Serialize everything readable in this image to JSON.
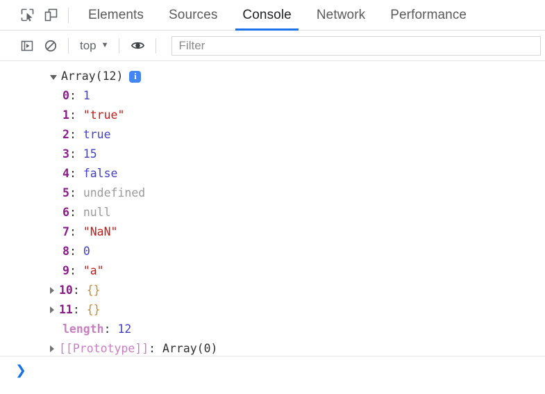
{
  "tabbar": {
    "inspect_icon": "inspect-element-icon",
    "device_icon": "device-toolbar-icon",
    "tabs": [
      {
        "label": "Elements",
        "active": false
      },
      {
        "label": "Sources",
        "active": false
      },
      {
        "label": "Console",
        "active": true
      },
      {
        "label": "Network",
        "active": false
      },
      {
        "label": "Performance",
        "active": false
      }
    ]
  },
  "console_toolbar": {
    "sidebar_icon": "console-sidebar-icon",
    "clear_icon": "clear-console-icon",
    "context_label": "top",
    "context_caret": "▼",
    "eye_icon": "live-expression-eye-icon",
    "filter_placeholder": "Filter",
    "filter_value": ""
  },
  "console_output": {
    "header": {
      "expanded": true,
      "text": "Array(12)",
      "badge": "i"
    },
    "entries": [
      {
        "key": "0",
        "colon": ": ",
        "value": "1",
        "value_class": "v-num",
        "key_class": "k-index",
        "expandable": false
      },
      {
        "key": "1",
        "colon": ": ",
        "value": "\"true\"",
        "value_class": "v-str",
        "key_class": "k-index",
        "expandable": false
      },
      {
        "key": "2",
        "colon": ": ",
        "value": "true",
        "value_class": "v-bool",
        "key_class": "k-index",
        "expandable": false
      },
      {
        "key": "3",
        "colon": ": ",
        "value": "15",
        "value_class": "v-num",
        "key_class": "k-index",
        "expandable": false
      },
      {
        "key": "4",
        "colon": ": ",
        "value": "false",
        "value_class": "v-bool",
        "key_class": "k-index",
        "expandable": false
      },
      {
        "key": "5",
        "colon": ": ",
        "value": "undefined",
        "value_class": "v-void",
        "key_class": "k-index",
        "expandable": false
      },
      {
        "key": "6",
        "colon": ": ",
        "value": "null",
        "value_class": "v-void",
        "key_class": "k-index",
        "expandable": false
      },
      {
        "key": "7",
        "colon": ": ",
        "value": "\"NaN\"",
        "value_class": "v-str",
        "key_class": "k-index",
        "expandable": false
      },
      {
        "key": "8",
        "colon": ": ",
        "value": "0",
        "value_class": "v-num",
        "key_class": "k-index",
        "expandable": false
      },
      {
        "key": "9",
        "colon": ": ",
        "value": "\"a\"",
        "value_class": "v-str",
        "key_class": "k-index",
        "expandable": false
      },
      {
        "key": "10",
        "colon": ": ",
        "value": "{}",
        "value_class": "v-obj",
        "key_class": "k-index",
        "expandable": true
      },
      {
        "key": "11",
        "colon": ": ",
        "value": "{}",
        "value_class": "v-obj",
        "key_class": "k-index",
        "expandable": true
      },
      {
        "key": "length",
        "colon": ": ",
        "value": "12",
        "value_class": "v-num",
        "key_class": "k-prop",
        "expandable": false
      },
      {
        "key": "[[Prototype]]",
        "colon": ": ",
        "value": "Array(0)",
        "value_class": "v-plain",
        "key_class": "k-proto",
        "expandable": true
      }
    ]
  },
  "prompt": {
    "chevron": "❯",
    "value": "",
    "placeholder": ""
  },
  "colors": {
    "accent": "#1a73e8",
    "badge_blue": "#4285f4",
    "string_red": "#c41a16",
    "number_blue": "#4040c8",
    "index_magenta": "#8b1a8b",
    "prop_pink": "#c77fc0",
    "muted_gray": "#9a9a9a",
    "object_brace": "#c98a3a"
  }
}
